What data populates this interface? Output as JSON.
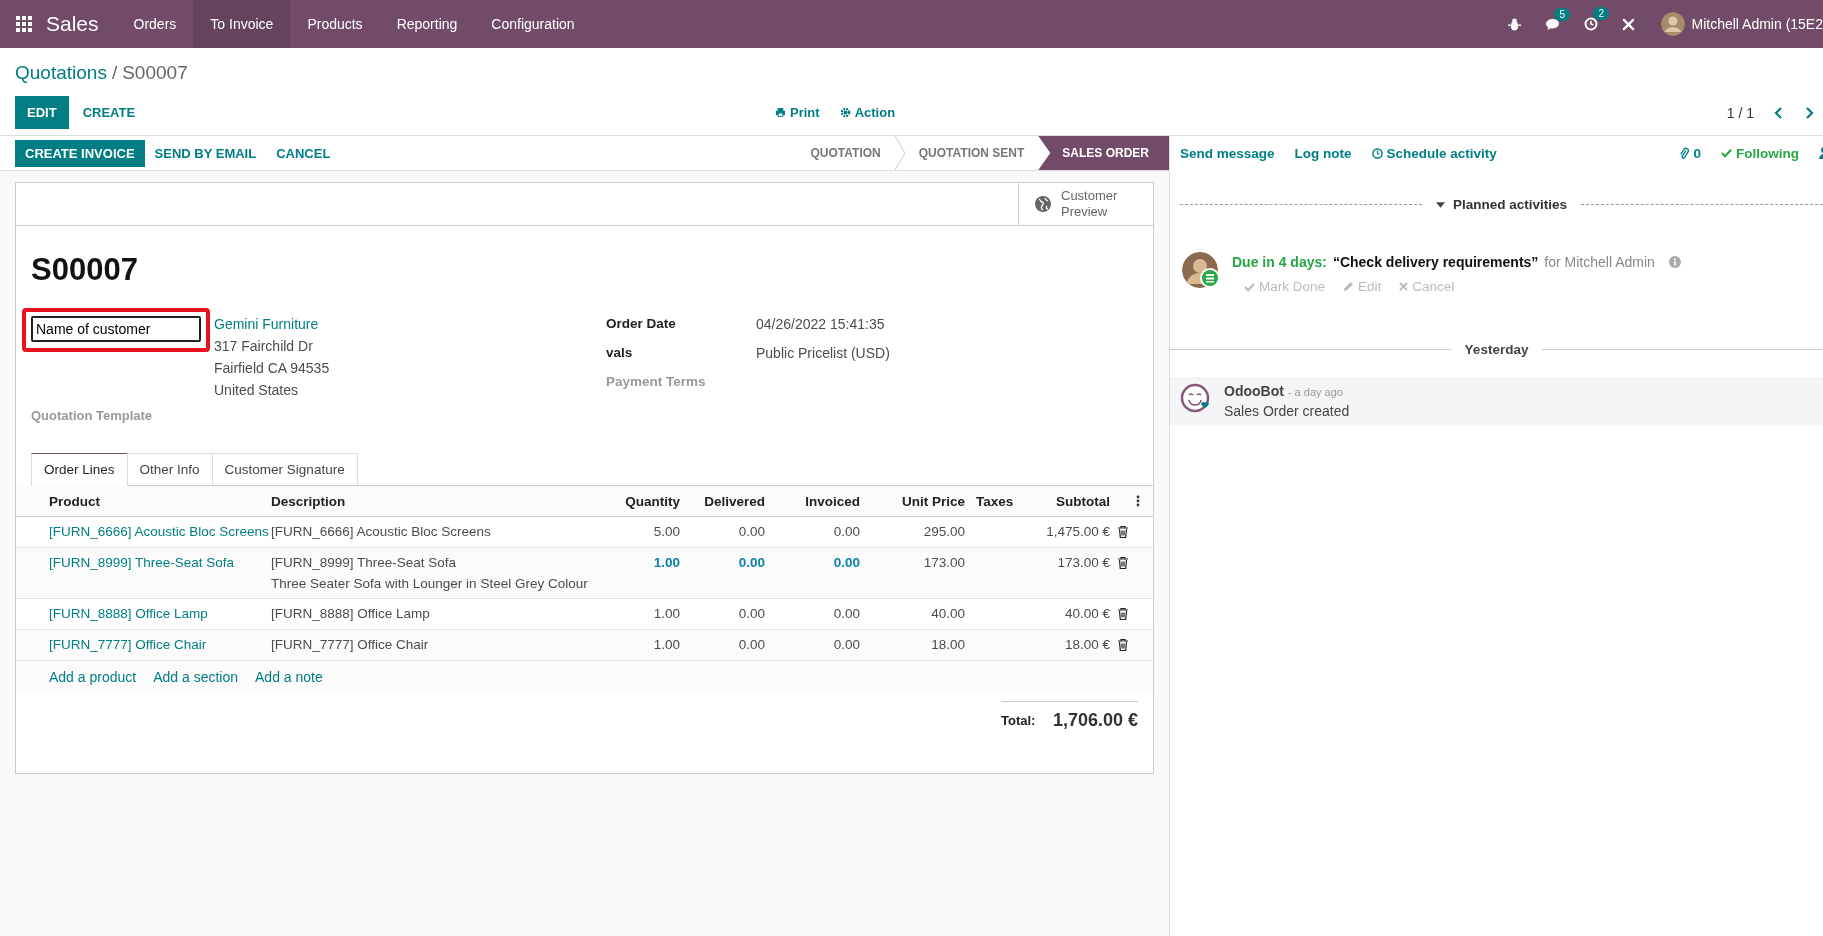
{
  "navbar": {
    "app": "Sales",
    "menus": [
      {
        "label": "Orders",
        "selected": false
      },
      {
        "label": "To Invoice",
        "selected": true
      },
      {
        "label": "Products",
        "selected": false
      },
      {
        "label": "Reporting",
        "selected": false
      },
      {
        "label": "Configuration",
        "selected": false
      }
    ],
    "systray": [
      {
        "kind": "bug"
      },
      {
        "kind": "chat",
        "badge": "5"
      },
      {
        "kind": "activity",
        "badge": "2"
      },
      {
        "kind": "tools"
      }
    ],
    "user": "Mitchell Admin (15E2"
  },
  "breadcrumb": {
    "parent": "Quotations",
    "separator": "/",
    "current": "S00007"
  },
  "buttons": [
    {
      "label": "EDIT",
      "primary": true
    },
    {
      "label": "CREATE",
      "primary": false
    }
  ],
  "actions": [
    {
      "kind": "print",
      "label": "Print"
    },
    {
      "kind": "gear",
      "label": "Action"
    }
  ],
  "pager": "1 / 1",
  "statusbar": {
    "buttons": [
      {
        "label": "CREATE INVOICE",
        "primary": true
      },
      {
        "label": "SEND BY EMAIL",
        "primary": false
      },
      {
        "label": "CANCEL",
        "primary": false
      }
    ],
    "stages": [
      {
        "label": "QUOTATION",
        "selected": false
      },
      {
        "label": "QUOTATION SENT",
        "selected": false
      },
      {
        "label": "SALES ORDER",
        "selected": true
      }
    ]
  },
  "sheet": {
    "preview_button": "Customer Preview",
    "title": "S00007",
    "customer_field": {
      "value": "Name of customer",
      "highlighted": true
    },
    "partner": {
      "name": "Gemini Furniture",
      "address": [
        "317 Fairchild Dr",
        "Fairfield CA 94535",
        "United States"
      ]
    },
    "template_label": "Quotation Template",
    "fields": [
      {
        "label": "Order Date",
        "value": "04/26/2022 15:41:35",
        "muted": false
      },
      {
        "label": "vals",
        "value": "Public Pricelist (USD)",
        "muted": false
      },
      {
        "label": "Payment Terms",
        "muted": true
      }
    ],
    "tabs": [
      {
        "label": "Order Lines",
        "selected": true
      },
      {
        "label": "Other Info",
        "selected": false
      },
      {
        "label": "Customer Signature",
        "selected": false
      }
    ],
    "table": {
      "columns": [
        "Product",
        "Description",
        "Quantity",
        "Delivered",
        "Invoiced",
        "Unit Price",
        "Taxes",
        "Subtotal"
      ],
      "rows": [
        {
          "product": "[FURN_6666] Acoustic Bloc Screens",
          "description": [
            "[FURN_6666] Acoustic Bloc Screens"
          ],
          "quantity": "5.00",
          "delivered": "0.00",
          "invoiced": "0.00",
          "unit_price": "295.00",
          "subtotal": "1,475.00 €",
          "highlight": false
        },
        {
          "product": "[FURN_8999] Three-Seat Sofa",
          "description": [
            "[FURN_8999] Three-Seat Sofa",
            "Three Seater Sofa with Lounger in Steel Grey Colour"
          ],
          "quantity": "1.00",
          "delivered": "0.00",
          "invoiced": "0.00",
          "unit_price": "173.00",
          "subtotal": "173.00 €",
          "highlight": true
        },
        {
          "product": "[FURN_8888] Office Lamp",
          "description": [
            "[FURN_8888] Office Lamp"
          ],
          "quantity": "1.00",
          "delivered": "0.00",
          "invoiced": "0.00",
          "unit_price": "40.00",
          "subtotal": "40.00 €",
          "highlight": false
        },
        {
          "product": "[FURN_7777] Office Chair",
          "description": [
            "[FURN_7777] Office Chair"
          ],
          "quantity": "1.00",
          "delivered": "0.00",
          "invoiced": "0.00",
          "unit_price": "18.00",
          "subtotal": "18.00 €",
          "highlight": false
        }
      ],
      "add_links": [
        "Add a product",
        "Add a section",
        "Add a note"
      ]
    },
    "total": {
      "label": "Total:",
      "value": "1,706.00 €"
    }
  },
  "chatter": {
    "buttons": [
      {
        "label": "Send message",
        "kind": "text"
      },
      {
        "label": "Log note",
        "kind": "text"
      },
      {
        "label": "Schedule activity",
        "kind": "clock"
      }
    ],
    "attachments": "0",
    "following": "Following",
    "planned_header": "Planned activities",
    "activity": {
      "due": "Due in 4 days:",
      "summary": "“Check delivery requirements”",
      "assignee": "for Mitchell Admin",
      "actions": [
        {
          "kind": "check",
          "label": "Mark Done"
        },
        {
          "kind": "pencil",
          "label": "Edit"
        },
        {
          "kind": "cross",
          "label": "Cancel"
        }
      ]
    },
    "separator": "Yesterday",
    "message": {
      "author": "OdooBot",
      "time": "- a day ago",
      "body": "Sales Order created"
    }
  }
}
